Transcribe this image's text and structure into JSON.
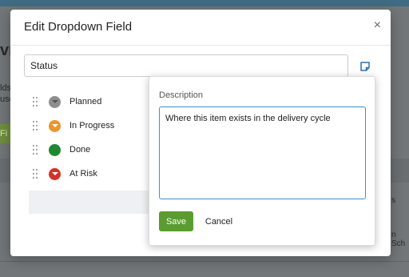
{
  "background": {
    "title_fragment": "vn",
    "text_line1": "lds",
    "text_line2": "use",
    "green_button_fragment": "Fi",
    "right_fragment1": "s",
    "right_fragment2": "n Sch"
  },
  "modal": {
    "title": "Edit Dropdown Field",
    "close_icon": "×",
    "field_name_value": "Status",
    "note_icon": "note-icon"
  },
  "options": [
    {
      "label": "Planned",
      "color": "#8e8e8e",
      "arrow": true
    },
    {
      "label": "In Progress",
      "color": "#f0932b",
      "arrow": true
    },
    {
      "label": "Done",
      "color": "#1e8a2f",
      "arrow": false
    },
    {
      "label": "At Risk",
      "color": "#d93025",
      "arrow": true
    }
  ],
  "popover": {
    "label": "Description",
    "value": "Where this item exists in the delivery cycle",
    "save_label": "Save",
    "cancel_label": "Cancel"
  },
  "colors": {
    "accent_green": "#5a9c2e",
    "focus_blue": "#3f8ed0"
  }
}
